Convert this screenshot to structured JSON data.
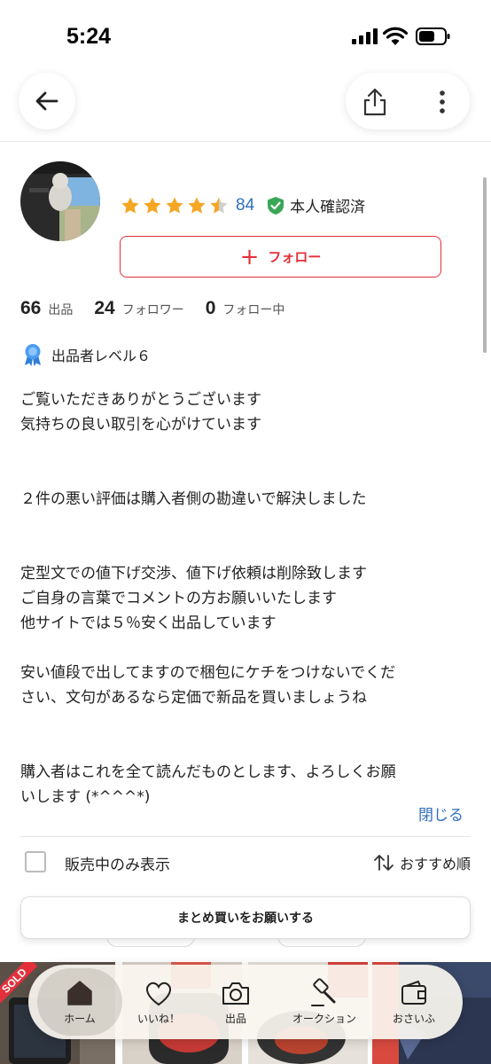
{
  "status_bar": {
    "time": "5:24"
  },
  "profile": {
    "rating_count": "84",
    "rating_stars": 4.5,
    "verified_label": "本人確認済",
    "follow_label": "フォロー",
    "stats": [
      {
        "value": "66",
        "label": "出品"
      },
      {
        "value": "24",
        "label": "フォロワー"
      },
      {
        "value": "0",
        "label": "フォロー中"
      }
    ],
    "level_label": "出品者レベル６",
    "bio_lines": [
      "ご覧いただきありがとうございます",
      "気持ちの良い取引を心がけています",
      "",
      "",
      "２件の悪い評価は購入者側の勘違いで解決しました",
      "",
      "",
      "定型文での値下げ交渉、値下げ依頼は削除致します",
      "ご自身の言葉でコメントの方お願いいたします",
      "他サイトでは５％安く出品しています",
      "",
      "安い値段で出してますので梱包にケチをつけないでくだ",
      "さい、文句があるなら定価で新品を買いましょうね",
      "",
      "",
      "購入者はこれを全て読んだものとします、よろしくお願",
      "いします (*^^^*)"
    ],
    "close_label": "閉じる"
  },
  "filter": {
    "on_sale_only_label": "販売中のみ表示",
    "on_sale_only_checked": false,
    "sort_label": "おすすめ順"
  },
  "bulk_button_label": "まとめ買いをお願いする",
  "products": {
    "sold_badge": "SOLD"
  },
  "tabbar": {
    "active_index": 0,
    "items": [
      {
        "label": "ホーム",
        "icon": "home-icon"
      },
      {
        "label": "いいね！",
        "icon": "heart-icon"
      },
      {
        "label": "出品",
        "icon": "camera-icon"
      },
      {
        "label": "オークション",
        "icon": "gavel-icon"
      },
      {
        "label": "おさいふ",
        "icon": "wallet-icon"
      }
    ]
  },
  "colors": {
    "accent_red": "#e3303b",
    "link_blue": "#2f6fc0",
    "star_gold": "#f5a623",
    "verified_green": "#3aa757"
  }
}
